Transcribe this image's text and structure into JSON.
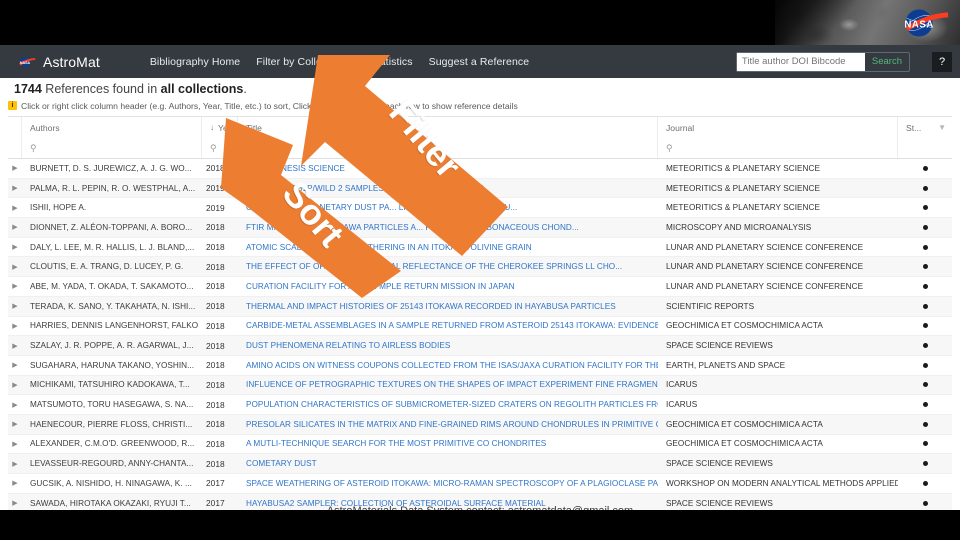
{
  "hero": {
    "nasa_logo_alt": "NASA insignia",
    "background_alt": "asteroid regolith surface photograph"
  },
  "navbar": {
    "brand": "AstroMat",
    "brand_logo": "nasa-meatball-icon",
    "links": [
      {
        "label": "Bibliography Home",
        "has_caret": false
      },
      {
        "label": "Filter by Collection",
        "has_caret": true
      },
      {
        "label": "Statistics",
        "has_caret": false
      },
      {
        "label": "Suggest a Reference",
        "has_caret": false
      }
    ],
    "search": {
      "placeholder": "Title author DOI Bibcode",
      "value": "",
      "button_label": "Search",
      "button_color": "#54b87a"
    },
    "help_icon": "question-circle-icon",
    "background": "#343a40"
  },
  "results": {
    "prefix": "1744",
    "middle": " References found in ",
    "collection": "all collections",
    "suffix": "."
  },
  "alert": {
    "icon": "info-icon",
    "icon_color": "#ffc107",
    "text": "Click or right click column header (e.g. Authors, Year, Title, etc.) to sort, Click arrow to the left of each row to show reference details"
  },
  "table": {
    "columns": [
      {
        "key": "authors",
        "label": "Authors",
        "sort_indicator": "",
        "filter_icon": false
      },
      {
        "key": "year",
        "label": "Year",
        "sort_indicator": "↓",
        "filter_icon": false
      },
      {
        "key": "title",
        "label": "Title",
        "sort_indicator": "",
        "filter_icon": false
      },
      {
        "key": "journal",
        "label": "Journal",
        "sort_indicator": "",
        "filter_icon": false
      },
      {
        "key": "status",
        "label": "St...",
        "sort_indicator": "",
        "filter_icon": true
      }
    ],
    "search_row_icon": "search-icon",
    "rows": [
      {
        "authors": "BURNETT, D. S. JUREWICZ, A. J. G. WO...",
        "year": "2018",
        "title": "... OF GENESIS SCIENCE",
        "journal": "METEORITICS & PLANETARY SCIENCE",
        "status": "●"
      },
      {
        "authors": "PALMA, R. L. PEPIN, R. O. WESTPHAL, A...",
        "year": "2019",
        "title": "... IN COMET 81P/WILD 2 SAMPLES ... A STARDUST MISSION",
        "journal": "METEORITICS & PLANETARY SCIENCE",
        "status": "●"
      },
      {
        "authors": "ISHII, HOPE A.",
        "year": "2019",
        "title": "COMP... INTERPLANETARY DUST PA... LIKE OBJECTS IN A STARDU...",
        "journal": "METEORITICS & PLANETARY SCIENCE",
        "status": "●"
      },
      {
        "authors": "DIONNET, Z. ALÉON-TOPPANI, A. BORO...",
        "year": "2018",
        "title": "FTIR MICRO... FIVE ITOKAWA PARTICLES A... PRIMITIVE CARBONACEOUS CHOND...",
        "journal": "MICROSCOPY AND MICROANALYSIS",
        "status": "●"
      },
      {
        "authors": "DALY, L. LEE, M. R. HALLIS, L. J. BLAND,...",
        "year": "2018",
        "title": "ATOMIC SCALE D... RACE WEATHERING IN AN ITOKAWA OLIVINE GRAIN",
        "journal": "LUNAR AND PLANETARY SCIENCE CONFERENCE",
        "status": "●"
      },
      {
        "authors": "CLOUTIS, E. A. TRANG, D. LUCEY, P. G.",
        "year": "2018",
        "title": "THE EFFECT OF OPAQUE... SPECTRAL REFLECTANCE OF THE CHEROKEE SPRINGS LL CHO...",
        "journal": "LUNAR AND PLANETARY SCIENCE CONFERENCE",
        "status": "●"
      },
      {
        "authors": "ABE, M. YADA, T. OKADA, T. SAKAMOTO...",
        "year": "2018",
        "title": "CURATION FACILITY FOR ASTE... MPLE RETURN MISSION IN JAPAN",
        "journal": "LUNAR AND PLANETARY SCIENCE CONFERENCE",
        "status": "●"
      },
      {
        "authors": "TERADA, K. SANO, Y. TAKAHATA, N. ISHI...",
        "year": "2018",
        "title": "THERMAL AND IMPACT HISTORIES OF 25143 ITOKAWA RECORDED IN HAYABUSA PARTICLES",
        "journal": "SCIENTIFIC REPORTS",
        "status": "●"
      },
      {
        "authors": "HARRIES, DENNIS LANGENHORST, FALKO",
        "year": "2018",
        "title": "CARBIDE-METAL ASSEMBLAGES IN A SAMPLE RETURNED FROM ASTEROID 25143 ITOKAWA: EVIDENCE F...",
        "journal": "GEOCHIMICA ET COSMOCHIMICA ACTA",
        "status": "●"
      },
      {
        "authors": "SZALAY, J. R. POPPE, A. R. AGARWAL, J...",
        "year": "2018",
        "title": "DUST PHENOMENA RELATING TO AIRLESS BODIES",
        "journal": "SPACE SCIENCE REVIEWS",
        "status": "●"
      },
      {
        "authors": "SUGAHARA, HARUNA TAKANO, YOSHIN...",
        "year": "2018",
        "title": "AMINO ACIDS ON WITNESS COUPONS COLLECTED FROM THE ISAS/JAXA CURATION FACILITY FOR THE A...",
        "journal": "EARTH, PLANETS AND SPACE",
        "status": "●"
      },
      {
        "authors": "MICHIKAMI, TATSUHIRO KADOKAWA, T...",
        "year": "2018",
        "title": "INFLUENCE OF PETROGRAPHIC TEXTURES ON THE SHAPES OF IMPACT EXPERIMENT FINE FRAGMENTS ...",
        "journal": "ICARUS",
        "status": "●"
      },
      {
        "authors": "MATSUMOTO, TORU HASEGAWA, S. NA...",
        "year": "2018",
        "title": "POPULATION CHARACTERISTICS OF SUBMICROMETER-SIZED CRATERS ON REGOLITH PARTICLES FROM ...",
        "journal": "ICARUS",
        "status": "●"
      },
      {
        "authors": "HAENECOUR, PIERRE FLOSS, CHRISTI...",
        "year": "2018",
        "title": "PRESOLAR SILICATES IN THE MATRIX AND FINE-GRAINED RIMS AROUND CHONDRULES IN PRIMITIVE CO...",
        "journal": "GEOCHIMICA ET COSMOCHIMICA ACTA",
        "status": "●"
      },
      {
        "authors": "ALEXANDER, C.M.O'D. GREENWOOD, R...",
        "year": "2018",
        "title": "A MUTLI-TECHNIQUE SEARCH FOR THE MOST PRIMITIVE CO CHONDRITES",
        "journal": "GEOCHIMICA ET COSMOCHIMICA ACTA",
        "status": "●"
      },
      {
        "authors": "LEVASSEUR-REGOURD, ANNY-CHANTA...",
        "year": "2018",
        "title": "COMETARY DUST",
        "journal": "SPACE SCIENCE REVIEWS",
        "status": "●"
      },
      {
        "authors": "GUCSIK, A. NISHIDO, H. NINAGAWA, K. ...",
        "year": "2017",
        "title": "SPACE WEATHERING OF ASTEROID ITOKAWA: MICRO-RAMAN SPECTROSCOPY OF A PLAGIOCLASE PART...",
        "journal": "WORKSHOP ON MODERN ANALYTICAL METHODS APPLIED TO E...",
        "status": "●"
      },
      {
        "authors": "SAWADA, HIROTAKA OKAZAKI, RYUJI T...",
        "year": "2017",
        "title": "HAYABUSA2 SAMPLER: COLLECTION OF ASTEROIDAL SURFACE MATERIAL",
        "journal": "SPACE SCIENCE REVIEWS",
        "status": "●"
      }
    ]
  },
  "annotations": {
    "color": "#ED7D31",
    "filter_label": "Filter",
    "sort_label": "Sort"
  },
  "footer": {
    "text": "AstroMaterials Data System contact: astromatdata@gmail.com"
  }
}
